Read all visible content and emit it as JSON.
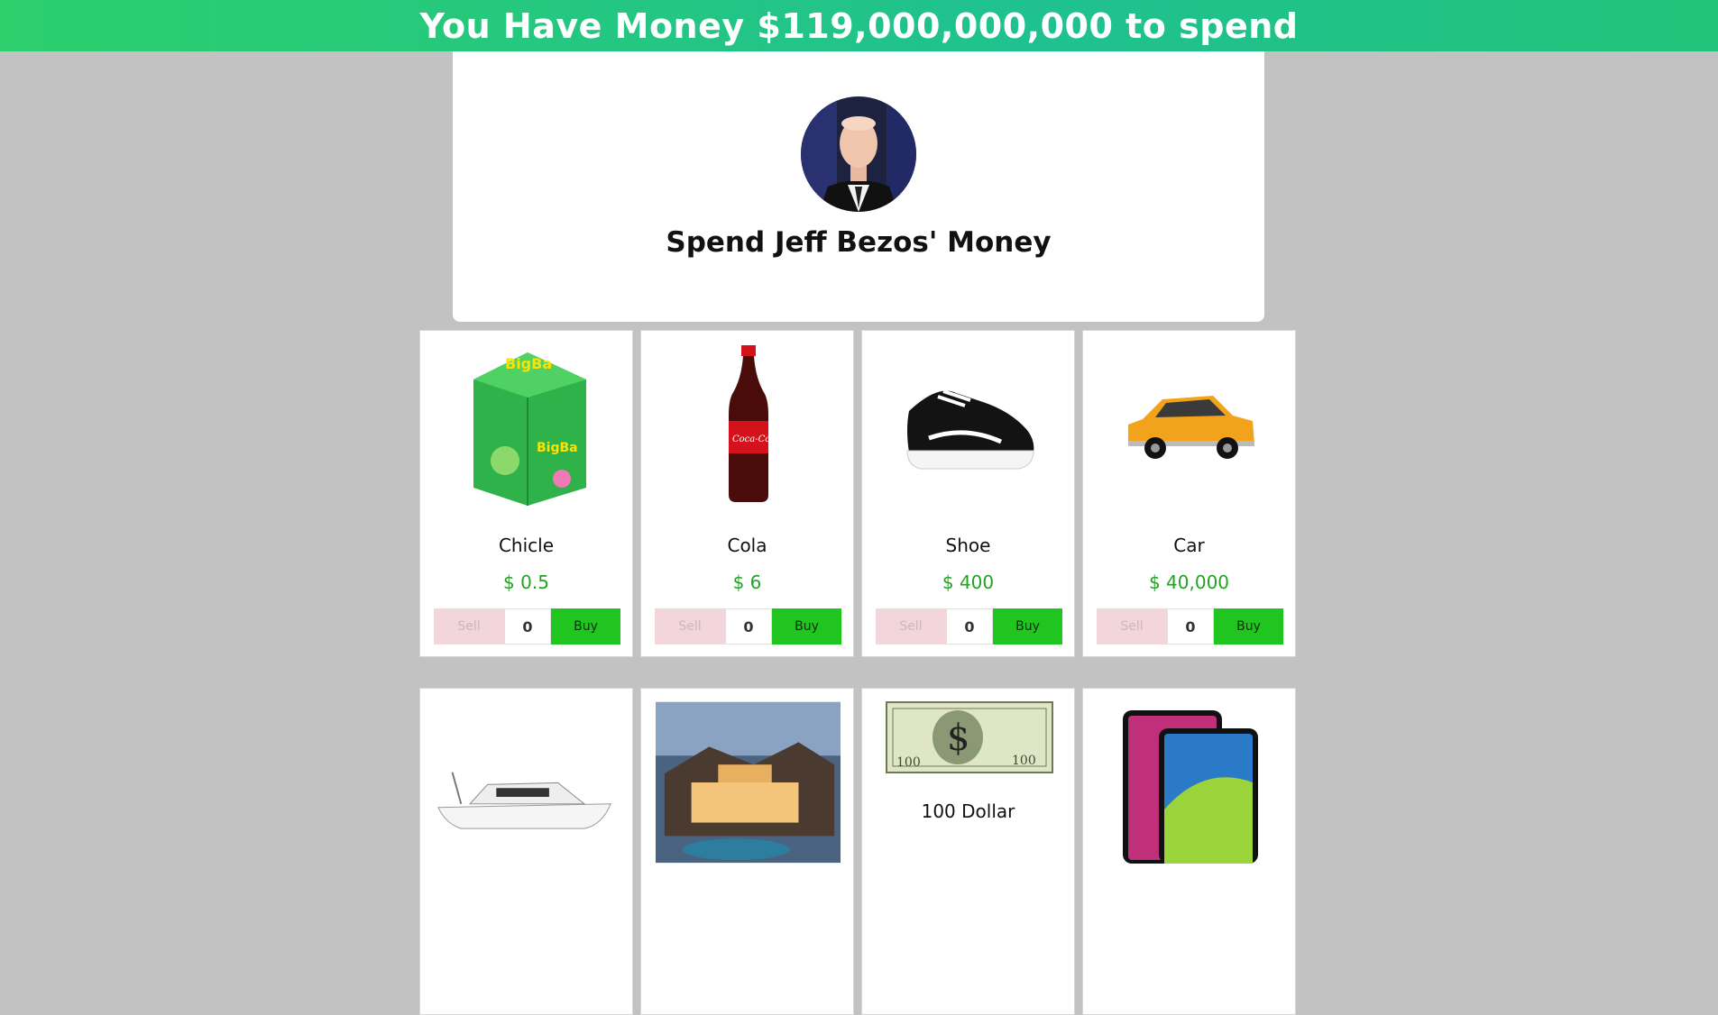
{
  "banner": {
    "text": "You Have Money $119,000,000,000 to spend"
  },
  "hero": {
    "title": "Spend Jeff Bezos' Money"
  },
  "controls": {
    "sell_label": "Sell",
    "buy_label": "Buy",
    "qty_value": "0"
  },
  "items": [
    {
      "name": "Chicle",
      "price": "$ 0.5",
      "qty": "0"
    },
    {
      "name": "Cola",
      "price": "$ 6",
      "qty": "0"
    },
    {
      "name": "Shoe",
      "price": "$ 400",
      "qty": "0"
    },
    {
      "name": "Car",
      "price": "$ 40,000",
      "qty": "0"
    },
    {
      "name": "",
      "price": ""
    },
    {
      "name": "",
      "price": ""
    },
    {
      "name": "100 Dollar",
      "price": ""
    },
    {
      "name": "",
      "price": ""
    }
  ],
  "colors": {
    "banner": "#1fc190",
    "price": "#23a323",
    "buy": "#20c520",
    "sell": "#f2d6dc",
    "background": "#c2c2c2"
  }
}
